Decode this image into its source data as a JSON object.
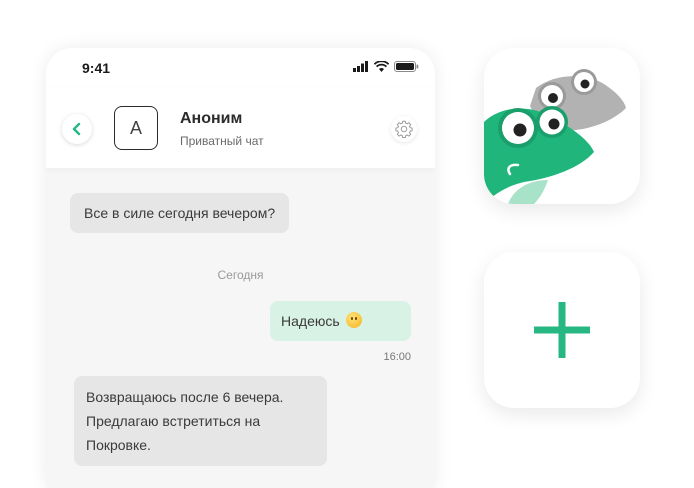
{
  "status_bar": {
    "time": "9:41"
  },
  "chat_header": {
    "avatar_letter": "A",
    "name": "Аноним",
    "subtitle": "Приватный чат"
  },
  "messages": {
    "m1": "Все в силе сегодня вечером?",
    "day_separator": "Сегодня",
    "m2": "Надеюсь",
    "m2_time": "16:00",
    "m3": "Возвращаюсь после 6 вечера. Предлагаю встретиться на Покровке."
  },
  "icons": {
    "back": "chevron-left-icon",
    "settings": "gear-icon",
    "app": "frog-mascot-icon",
    "add": "plus-icon",
    "emoji": "smiley-emoji-icon"
  },
  "colors": {
    "accent_green": "#27b783",
    "outgoing_bubble": "#d9f2e6",
    "incoming_bubble": "#e6e6e6"
  }
}
